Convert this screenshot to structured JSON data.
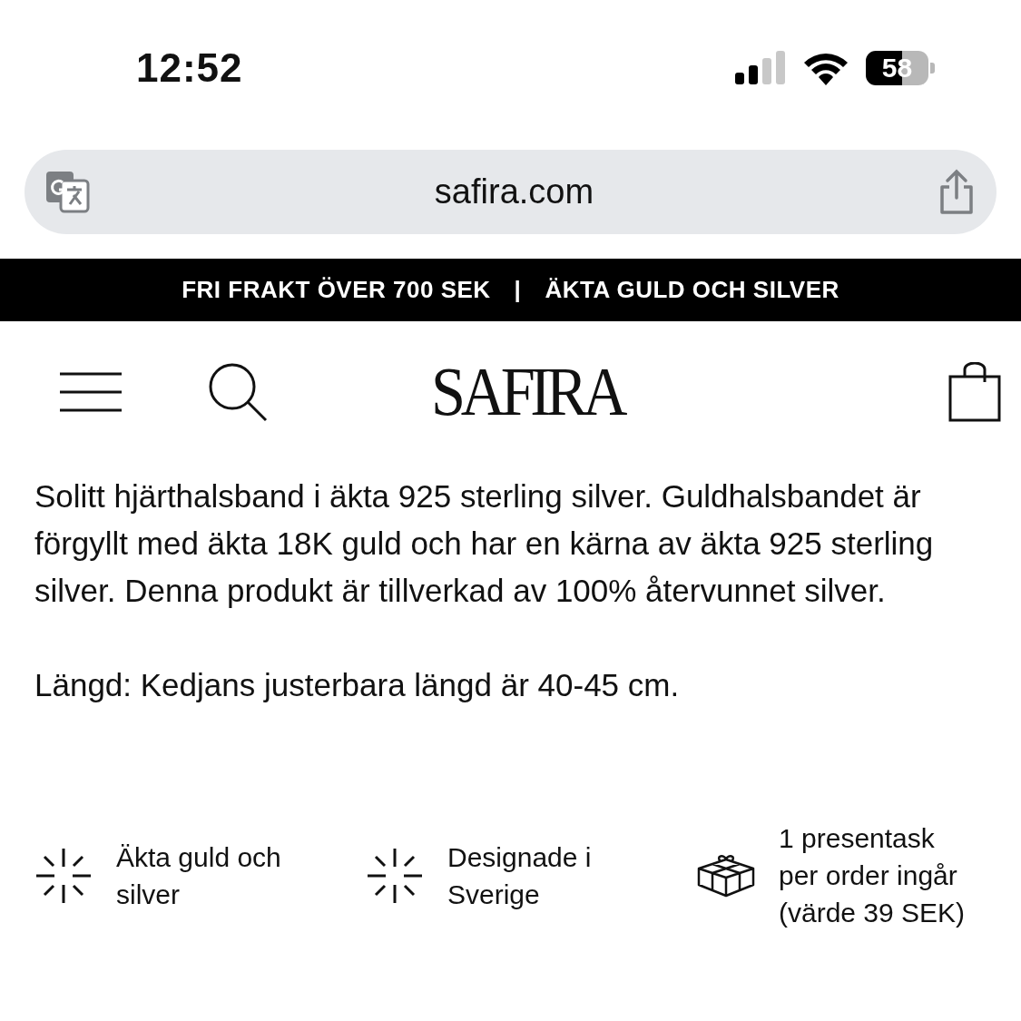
{
  "status_bar": {
    "time": "12:52",
    "battery": "58"
  },
  "browser": {
    "url": "safira.com"
  },
  "promo_banner": {
    "left": "FRI FRAKT ÖVER 700 SEK",
    "separator": "|",
    "right": "ÄKTA GULD OCH SILVER"
  },
  "header": {
    "logo": "SAFIRA"
  },
  "description": {
    "paragraphs": [
      "Solitt hjärthalsband i äkta 925 sterling silver. Guldhalsbandet är förgyllt med äkta 18K guld och har en kärna av äkta 925 sterling silver. Denna produkt är tillverkad av 100% återvunnet silver.",
      "Längd: Kedjans justerbara längd är 40-45 cm."
    ]
  },
  "features": [
    {
      "kind": "sparkle",
      "text": "Äkta guld och silver"
    },
    {
      "kind": "sparkle",
      "text": "Designade i Sverige"
    },
    {
      "kind": "gift",
      "text": "1 presentask per order ingår (värde 39 SEK)"
    }
  ]
}
